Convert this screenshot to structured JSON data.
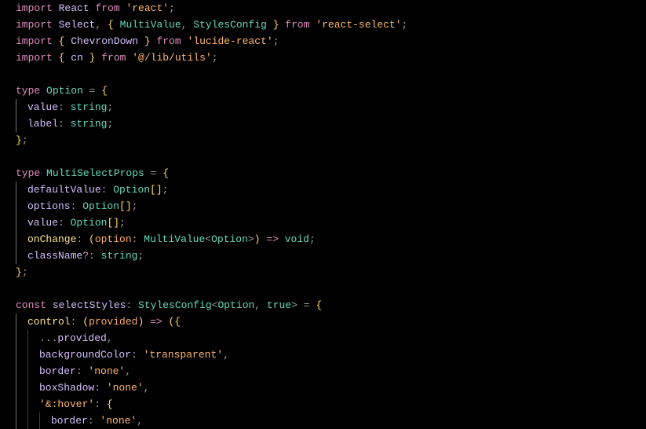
{
  "language": "typescript",
  "colors": {
    "background": "#000000",
    "keyword_control": "#e18dc0",
    "type": "#66d9bb",
    "variable": "#d6bfff",
    "string": "#ffb86c",
    "brace": "#ffd866",
    "function": "#fde58b",
    "param": "#ffad6a",
    "punct": "#9e9e9e"
  },
  "lines": [
    {
      "indent": 0,
      "tokens": [
        {
          "t": "import ",
          "c": "kw-control"
        },
        {
          "t": "React",
          "c": "variable"
        },
        {
          "t": " from ",
          "c": "kw-control"
        },
        {
          "t": "'react'",
          "c": "string"
        },
        {
          "t": ";",
          "c": "punct"
        }
      ]
    },
    {
      "indent": 0,
      "tokens": [
        {
          "t": "import ",
          "c": "kw-control"
        },
        {
          "t": "Select",
          "c": "variable"
        },
        {
          "t": ", ",
          "c": "punct"
        },
        {
          "t": "{ ",
          "c": "brace"
        },
        {
          "t": "MultiValue",
          "c": "kw-type"
        },
        {
          "t": ", ",
          "c": "punct"
        },
        {
          "t": "StylesConfig",
          "c": "kw-type"
        },
        {
          "t": " }",
          "c": "brace"
        },
        {
          "t": " from ",
          "c": "kw-control"
        },
        {
          "t": "'react-select'",
          "c": "string"
        },
        {
          "t": ";",
          "c": "punct"
        }
      ]
    },
    {
      "indent": 0,
      "tokens": [
        {
          "t": "import ",
          "c": "kw-control"
        },
        {
          "t": "{ ",
          "c": "brace"
        },
        {
          "t": "ChevronDown",
          "c": "variable"
        },
        {
          "t": " }",
          "c": "brace"
        },
        {
          "t": " from ",
          "c": "kw-control"
        },
        {
          "t": "'lucide-react'",
          "c": "string"
        },
        {
          "t": ";",
          "c": "punct"
        }
      ]
    },
    {
      "indent": 0,
      "tokens": [
        {
          "t": "import ",
          "c": "kw-control"
        },
        {
          "t": "{ ",
          "c": "brace"
        },
        {
          "t": "cn",
          "c": "variable"
        },
        {
          "t": " }",
          "c": "brace"
        },
        {
          "t": " from ",
          "c": "kw-control"
        },
        {
          "t": "'@/lib/utils'",
          "c": "string"
        },
        {
          "t": ";",
          "c": "punct"
        }
      ]
    },
    {
      "indent": 0,
      "tokens": []
    },
    {
      "indent": 0,
      "tokens": [
        {
          "t": "type ",
          "c": "kw-control"
        },
        {
          "t": "Option",
          "c": "typename-decl"
        },
        {
          "t": " = ",
          "c": "punct"
        },
        {
          "t": "{",
          "c": "brace"
        }
      ]
    },
    {
      "indent": 1,
      "guideActive": true,
      "tokens": [
        {
          "t": "value",
          "c": "prop"
        },
        {
          "t": ": ",
          "c": "punct"
        },
        {
          "t": "string",
          "c": "type-primitive"
        },
        {
          "t": ";",
          "c": "punct"
        }
      ]
    },
    {
      "indent": 1,
      "guideActive": true,
      "tokens": [
        {
          "t": "label",
          "c": "prop"
        },
        {
          "t": ": ",
          "c": "punct"
        },
        {
          "t": "string",
          "c": "type-primitive"
        },
        {
          "t": ";",
          "c": "punct"
        }
      ]
    },
    {
      "indent": 0,
      "tokens": [
        {
          "t": "}",
          "c": "brace"
        },
        {
          "t": ";",
          "c": "punct"
        }
      ]
    },
    {
      "indent": 0,
      "tokens": []
    },
    {
      "indent": 0,
      "tokens": [
        {
          "t": "type ",
          "c": "kw-control"
        },
        {
          "t": "MultiSelectProps",
          "c": "typename-decl"
        },
        {
          "t": " = ",
          "c": "punct"
        },
        {
          "t": "{",
          "c": "brace"
        }
      ]
    },
    {
      "indent": 1,
      "guideActive": true,
      "tokens": [
        {
          "t": "defaultValue",
          "c": "prop"
        },
        {
          "t": ": ",
          "c": "punct"
        },
        {
          "t": "Option",
          "c": "kw-type"
        },
        {
          "t": "[]",
          "c": "brace"
        },
        {
          "t": ";",
          "c": "punct"
        }
      ]
    },
    {
      "indent": 1,
      "guideActive": true,
      "tokens": [
        {
          "t": "options",
          "c": "prop"
        },
        {
          "t": ": ",
          "c": "punct"
        },
        {
          "t": "Option",
          "c": "kw-type"
        },
        {
          "t": "[]",
          "c": "brace"
        },
        {
          "t": ";",
          "c": "punct"
        }
      ]
    },
    {
      "indent": 1,
      "guideActive": true,
      "tokens": [
        {
          "t": "value",
          "c": "prop"
        },
        {
          "t": ": ",
          "c": "punct"
        },
        {
          "t": "Option",
          "c": "kw-type"
        },
        {
          "t": "[]",
          "c": "brace"
        },
        {
          "t": ";",
          "c": "punct"
        }
      ]
    },
    {
      "indent": 1,
      "guideActive": true,
      "tokens": [
        {
          "t": "onChange",
          "c": "func"
        },
        {
          "t": ": ",
          "c": "punct"
        },
        {
          "t": "(",
          "c": "brace"
        },
        {
          "t": "option",
          "c": "param"
        },
        {
          "t": ": ",
          "c": "punct"
        },
        {
          "t": "MultiValue",
          "c": "kw-type"
        },
        {
          "t": "<",
          "c": "punct"
        },
        {
          "t": "Option",
          "c": "kw-type"
        },
        {
          "t": ">",
          "c": "punct"
        },
        {
          "t": ")",
          "c": "brace"
        },
        {
          "t": " => ",
          "c": "arrow"
        },
        {
          "t": "void",
          "c": "kw-type"
        },
        {
          "t": ";",
          "c": "punct"
        }
      ]
    },
    {
      "indent": 1,
      "guideActive": true,
      "tokens": [
        {
          "t": "className",
          "c": "prop"
        },
        {
          "t": "?",
          "c": "optional"
        },
        {
          "t": ": ",
          "c": "punct"
        },
        {
          "t": "string",
          "c": "type-primitive"
        },
        {
          "t": ";",
          "c": "punct"
        }
      ]
    },
    {
      "indent": 0,
      "tokens": [
        {
          "t": "}",
          "c": "brace"
        },
        {
          "t": ";",
          "c": "punct"
        }
      ]
    },
    {
      "indent": 0,
      "tokens": []
    },
    {
      "indent": 0,
      "tokens": [
        {
          "t": "const ",
          "c": "kw-control"
        },
        {
          "t": "selectStyles",
          "c": "prop"
        },
        {
          "t": ": ",
          "c": "punct"
        },
        {
          "t": "StylesConfig",
          "c": "kw-type"
        },
        {
          "t": "<",
          "c": "punct"
        },
        {
          "t": "Option",
          "c": "kw-type"
        },
        {
          "t": ", ",
          "c": "punct"
        },
        {
          "t": "true",
          "c": "kw-type"
        },
        {
          "t": ">",
          "c": "punct"
        },
        {
          "t": " = ",
          "c": "punct"
        },
        {
          "t": "{",
          "c": "brace"
        }
      ]
    },
    {
      "indent": 1,
      "guideActive": true,
      "tokens": [
        {
          "t": "control",
          "c": "func"
        },
        {
          "t": ": ",
          "c": "punct"
        },
        {
          "t": "(",
          "c": "brace"
        },
        {
          "t": "provided",
          "c": "param"
        },
        {
          "t": ")",
          "c": "brace"
        },
        {
          "t": " => ",
          "c": "arrow"
        },
        {
          "t": "({",
          "c": "brace"
        }
      ]
    },
    {
      "indent": 2,
      "guideActive": true,
      "tokens": [
        {
          "t": "...",
          "c": "punct"
        },
        {
          "t": "provided",
          "c": "prop"
        },
        {
          "t": ",",
          "c": "punct"
        }
      ]
    },
    {
      "indent": 2,
      "guideActive": true,
      "tokens": [
        {
          "t": "backgroundColor",
          "c": "prop"
        },
        {
          "t": ": ",
          "c": "punct"
        },
        {
          "t": "'transparent'",
          "c": "string"
        },
        {
          "t": ",",
          "c": "punct"
        }
      ]
    },
    {
      "indent": 2,
      "guideActive": true,
      "tokens": [
        {
          "t": "border",
          "c": "prop"
        },
        {
          "t": ": ",
          "c": "punct"
        },
        {
          "t": "'none'",
          "c": "string"
        },
        {
          "t": ",",
          "c": "punct"
        }
      ]
    },
    {
      "indent": 2,
      "guideActive": true,
      "tokens": [
        {
          "t": "boxShadow",
          "c": "prop"
        },
        {
          "t": ": ",
          "c": "punct"
        },
        {
          "t": "'none'",
          "c": "string"
        },
        {
          "t": ",",
          "c": "punct"
        }
      ]
    },
    {
      "indent": 2,
      "guideActive": true,
      "tokens": [
        {
          "t": "'&:hover'",
          "c": "string"
        },
        {
          "t": ": ",
          "c": "punct"
        },
        {
          "t": "{",
          "c": "brace"
        }
      ]
    },
    {
      "indent": 3,
      "guideActive": true,
      "tokens": [
        {
          "t": "border",
          "c": "prop"
        },
        {
          "t": ": ",
          "c": "punct"
        },
        {
          "t": "'none'",
          "c": "string"
        },
        {
          "t": ",",
          "c": "punct"
        }
      ]
    }
  ]
}
